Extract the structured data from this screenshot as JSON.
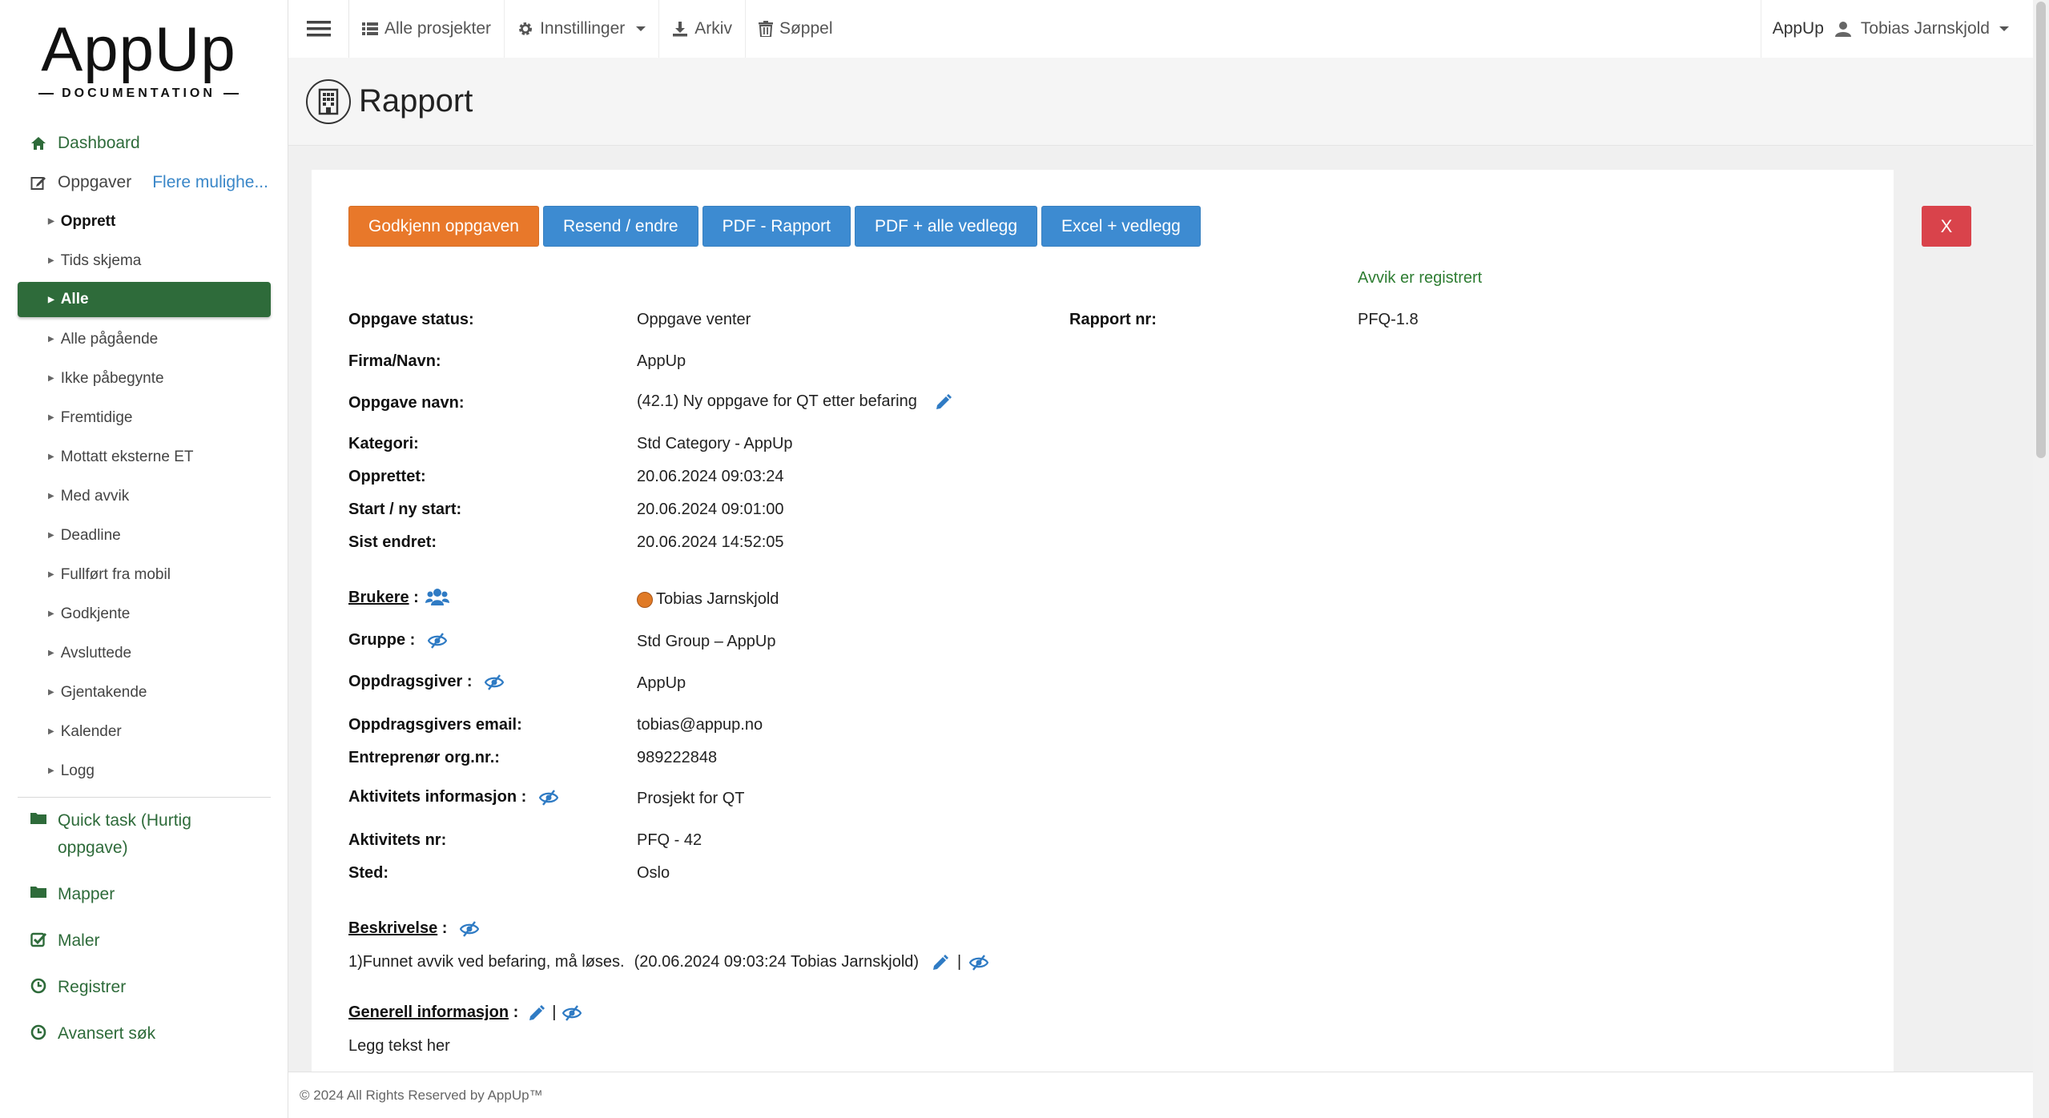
{
  "logo": {
    "main": "AppUp",
    "sub": "DOCUMENTATION"
  },
  "sidebar": {
    "dashboard": "Dashboard",
    "oppgaver": "Oppgaver",
    "more": "Flere mulighe...",
    "sub_items": [
      "Opprett",
      "Tids skjema",
      "Alle",
      "Alle pågående",
      "Ikke påbegynte",
      "Fremtidige",
      "Mottatt eksterne ET",
      "Med avvik",
      "Deadline",
      "Fullført fra mobil",
      "Godkjente",
      "Avsluttede",
      "Gjentakende",
      "Kalender",
      "Logg"
    ],
    "main_items": [
      "Quick task (Hurtig oppgave)",
      "Mapper",
      "Maler",
      "Registrer",
      "Avansert søk"
    ]
  },
  "topbar": {
    "all_projects": "Alle prosjekter",
    "settings": "Innstillinger",
    "archive": "Arkiv",
    "trash": "Søppel",
    "app": "AppUp",
    "user": "Tobias Jarnskjold"
  },
  "page": {
    "title": "Rapport"
  },
  "buttons": {
    "approve": "Godkjenn oppgaven",
    "resend": "Resend / endre",
    "pdf": "PDF - Rapport",
    "pdf_all": "PDF + alle vedlegg",
    "excel": "Excel + vedlegg",
    "close": "X"
  },
  "avvik": "Avvik er registrert",
  "fields": {
    "status_label": "Oppgave status:",
    "status_value": "Oppgave venter",
    "rapport_label": "Rapport nr:",
    "rapport_value": "PFQ-1.8",
    "firma_label": "Firma/Navn:",
    "firma_value": "AppUp",
    "navn_label": "Oppgave navn:",
    "navn_value": "(42.1) Ny oppgave for QT etter befaring",
    "kategori_label": "Kategori:",
    "kategori_value": "Std Category - AppUp",
    "opprettet_label": "Opprettet:",
    "opprettet_value": "20.06.2024 09:03:24",
    "start_label": "Start / ny start:",
    "start_value": "20.06.2024 09:01:00",
    "endret_label": "Sist endret:",
    "endret_value": "20.06.2024 14:52:05",
    "brukere_label": "Brukere",
    "brukere_value": "Tobias Jarnskjold",
    "gruppe_label": "Gruppe :",
    "gruppe_value": "Std Group – AppUp",
    "giver_label": "Oppdragsgiver :",
    "giver_value": "AppUp",
    "email_label": "Oppdragsgivers email:",
    "email_value": "tobias@appup.no",
    "org_label": "Entreprenør org.nr.:",
    "org_value": "989222848",
    "aktinfo_label": "Aktivitets informasjon :",
    "aktinfo_value": "Prosjekt for QT",
    "aktnr_label": "Aktivitets nr:",
    "aktnr_value": "PFQ - 42",
    "sted_label": "Sted:",
    "sted_value": "Oslo"
  },
  "beskrivelse": {
    "label": "Beskrivelse",
    "text": "1)Funnet avvik ved befaring, må løses.",
    "meta": "(20.06.2024 09:03:24  Tobias Jarnskjold)"
  },
  "generell": {
    "label": "Generell informasjon",
    "text": "Legg tekst her"
  },
  "footer": "© 2024 All Rights Reserved by AppUp™",
  "colors": {
    "green": "#2e6b3a",
    "orange": "#e8782a",
    "blue": "#3d8bd1",
    "red": "#d9434b"
  }
}
